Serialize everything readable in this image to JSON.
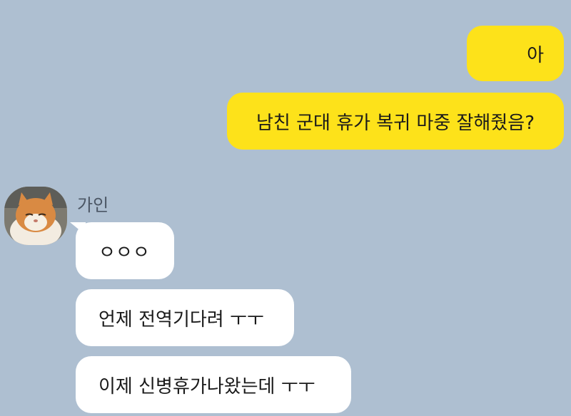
{
  "conversation": {
    "messages": [
      {
        "direction": "sent",
        "text": "아"
      },
      {
        "direction": "sent",
        "text": "남친 군대 휴가 복귀 마중 잘해줬음?"
      },
      {
        "direction": "received",
        "text": "ㅇㅇㅇ"
      },
      {
        "direction": "received",
        "text": "언제 전역기다려 ㅜㅜ"
      },
      {
        "direction": "received",
        "text": "이제 신병휴가나왔는데 ㅜㅜ"
      }
    ],
    "contact": {
      "name": "가인",
      "avatar_icon": "cat-photo-avatar"
    }
  },
  "colors": {
    "background": "#aebfd1",
    "sent_bubble": "#fde21a",
    "received_bubble": "#ffffff",
    "sender_name": "#4b5664"
  }
}
